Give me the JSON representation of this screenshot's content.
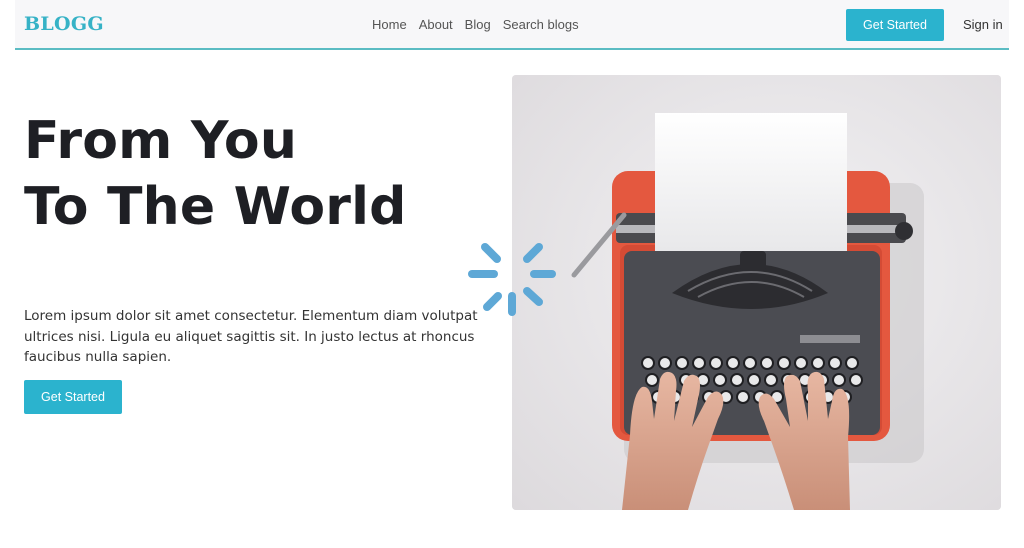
{
  "brand": {
    "logo": "BLOGG"
  },
  "nav": {
    "links": [
      {
        "label": "Home"
      },
      {
        "label": "About"
      },
      {
        "label": "Blog"
      },
      {
        "label": "Search blogs"
      }
    ],
    "cta_label": "Get Started",
    "signin_label": "Sign in"
  },
  "hero": {
    "title_line1": "From You",
    "title_line2": "To The World",
    "description": "Lorem ipsum dolor sit amet consectetur. Elementum diam volutpat ultrices nisi. Ligula eu aliquet sagittis sit. In justo lectus at rhoncus faucibus nulla sapien.",
    "cta_label": "Get Started",
    "image": "typewriter-photo"
  },
  "loading_indicator": "spinner-icon",
  "colors": {
    "accent": "#2bb3ce",
    "logo": "#36b2c6",
    "nav_border": "#5bbcc3",
    "heading": "#1e1f24",
    "spinner": "#5ea8d6"
  }
}
